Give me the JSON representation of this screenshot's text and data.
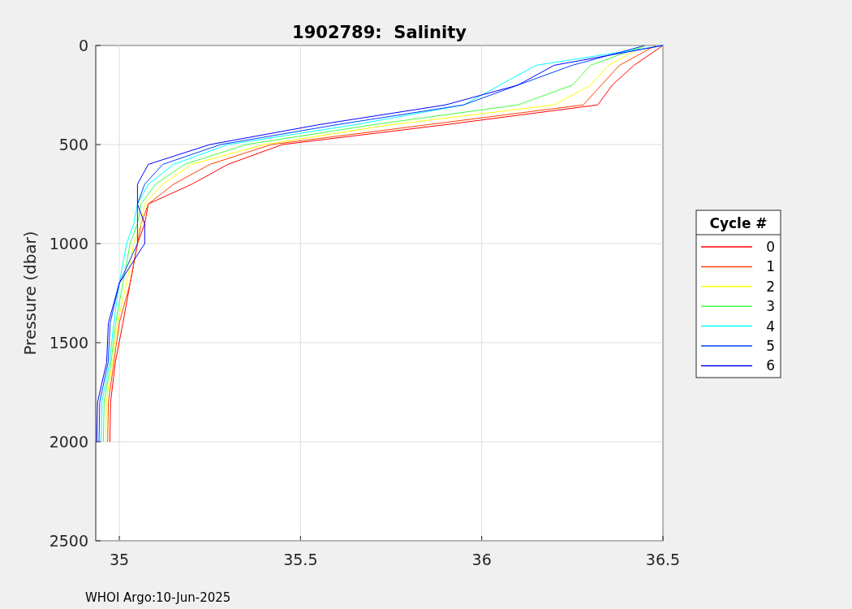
{
  "figure": {
    "chart_data": {
      "type": "line",
      "title": "1902789:  Salinity",
      "ylabel": "Pressure (dbar)",
      "series": [
        {
          "name": "0",
          "color": "#ff0000",
          "x": [
            36.5,
            36.42,
            36.36,
            36.32,
            35.9,
            35.45,
            35.3,
            35.2,
            35.08,
            35.07,
            35.05,
            35.03,
            35.01,
            34.989,
            34.976,
            34.974
          ],
          "values": [
            0,
            100,
            200,
            300,
            400,
            500,
            600,
            700,
            800,
            900,
            1000,
            1200,
            1400,
            1600,
            1800,
            2000
          ]
        },
        {
          "name": "1",
          "color": "#ff4000",
          "x": [
            36.48,
            36.38,
            36.33,
            36.28,
            35.85,
            35.42,
            35.25,
            35.15,
            35.08,
            35.06,
            35.05,
            35.03,
            35.0,
            34.985,
            34.97,
            34.968
          ],
          "values": [
            0,
            100,
            200,
            300,
            400,
            500,
            600,
            700,
            800,
            900,
            1000,
            1200,
            1400,
            1600,
            1800,
            2000
          ]
        },
        {
          "name": "2",
          "color": "#ffff00",
          "x": [
            36.45,
            36.35,
            36.3,
            36.2,
            35.75,
            35.4,
            35.2,
            35.12,
            35.07,
            35.06,
            35.04,
            35.02,
            34.995,
            34.981,
            34.964,
            34.962
          ],
          "values": [
            0,
            100,
            200,
            300,
            400,
            500,
            600,
            700,
            800,
            900,
            1000,
            1200,
            1400,
            1600,
            1800,
            2000
          ]
        },
        {
          "name": "3",
          "color": "#40ff40",
          "x": [
            36.45,
            36.3,
            36.25,
            36.1,
            35.7,
            35.35,
            35.18,
            35.1,
            35.06,
            35.05,
            35.03,
            35.01,
            34.99,
            34.977,
            34.958,
            34.956
          ],
          "values": [
            0,
            100,
            200,
            300,
            400,
            500,
            600,
            700,
            800,
            900,
            1000,
            1200,
            1400,
            1600,
            1800,
            2000
          ]
        },
        {
          "name": "4",
          "color": "#00ffff",
          "x": [
            36.5,
            36.15,
            36.05,
            35.95,
            35.65,
            35.3,
            35.15,
            35.08,
            35.05,
            35.04,
            35.02,
            35.0,
            34.985,
            34.973,
            34.952,
            34.95
          ],
          "values": [
            0,
            100,
            200,
            300,
            400,
            500,
            600,
            700,
            800,
            900,
            1000,
            1200,
            1400,
            1600,
            1800,
            2000
          ]
        },
        {
          "name": "5",
          "color": "#0040ff",
          "x": [
            36.45,
            36.25,
            36.1,
            35.95,
            35.6,
            35.28,
            35.12,
            35.07,
            35.05,
            35.05,
            35.05,
            35.0,
            34.975,
            34.969,
            34.946,
            34.944
          ],
          "values": [
            0,
            100,
            200,
            300,
            400,
            500,
            600,
            700,
            800,
            900,
            1000,
            1200,
            1400,
            1600,
            1800,
            2000
          ]
        },
        {
          "name": "6",
          "color": "#0000ff",
          "x": [
            36.5,
            36.2,
            36.1,
            35.9,
            35.55,
            35.25,
            35.08,
            35.05,
            35.05,
            35.07,
            35.07,
            35.0,
            34.97,
            34.965,
            34.94,
            34.938
          ],
          "values": [
            0,
            100,
            200,
            300,
            400,
            500,
            600,
            700,
            800,
            900,
            1000,
            1200,
            1400,
            1600,
            1800,
            2000
          ]
        }
      ],
      "xlim": [
        34.935,
        36.5
      ],
      "ylim": [
        2500,
        0
      ],
      "xticks": [
        {
          "value": 35,
          "label": "35"
        },
        {
          "value": 35.5,
          "label": "35.5"
        },
        {
          "value": 36,
          "label": "36"
        },
        {
          "value": 36.5,
          "label": "36.5"
        }
      ],
      "yticks": [
        {
          "value": 0,
          "label": "0"
        },
        {
          "value": 500,
          "label": "500"
        },
        {
          "value": 1000,
          "label": "1000"
        },
        {
          "value": 1500,
          "label": "1500"
        },
        {
          "value": 2000,
          "label": "2000"
        },
        {
          "value": 2500,
          "label": "2500"
        }
      ],
      "grid": true,
      "legend": {
        "title": "Cycle #"
      }
    },
    "footer": "WHOI Argo:10-Jun-2025"
  }
}
